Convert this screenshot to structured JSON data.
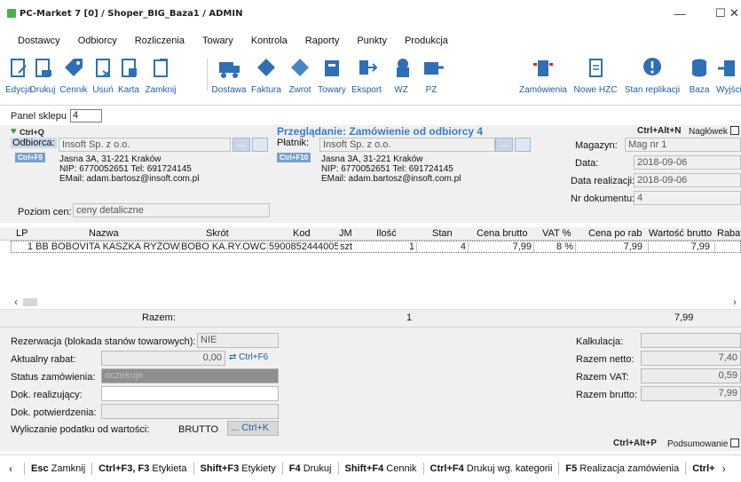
{
  "window": {
    "title": "PC-Market 7 [0] / Shoper_BIG_Baza1 / ADMIN",
    "minimize": "—",
    "maximize": "☐",
    "close": "✕"
  },
  "menu": [
    "Dostawcy",
    "Odbiorcy",
    "Rozliczenia",
    "Towary",
    "Kontrola",
    "Raporty",
    "Punkty",
    "Produkcja"
  ],
  "toolbar": [
    {
      "label": "Edycja",
      "icon": "edit-doc-icon"
    },
    {
      "label": "Drukuj",
      "icon": "print-doc-icon"
    },
    {
      "label": "Cennik",
      "icon": "price-tag-icon"
    },
    {
      "label": "Usuń",
      "icon": "delete-doc-icon"
    },
    {
      "label": "Karta",
      "icon": "card-icon"
    },
    {
      "label": "Zamknij",
      "icon": "close-doc-icon"
    },
    {
      "label": "Dostawa",
      "icon": "delivery-icon"
    },
    {
      "label": "Faktura",
      "icon": "invoice-icon"
    },
    {
      "label": "Zwrot",
      "icon": "return-icon"
    },
    {
      "label": "Towary",
      "icon": "goods-icon"
    },
    {
      "label": "Eksport",
      "icon": "export-icon"
    },
    {
      "label": "WZ",
      "icon": "wz-icon"
    },
    {
      "label": "PZ",
      "icon": "pz-icon"
    },
    {
      "label": "Zamówienia",
      "icon": "orders-icon"
    },
    {
      "label": "Nowe HZC",
      "icon": "new-hzc-icon"
    },
    {
      "label": "Stan replikacji",
      "icon": "replication-icon"
    },
    {
      "label": "Baza",
      "icon": "database-icon"
    },
    {
      "label": "Wyjście",
      "icon": "exit-icon"
    }
  ],
  "panel": {
    "label": "Panel sklepu",
    "value": "4"
  },
  "header": {
    "ctrl_q": "Ctrl+Q",
    "preview_title": "Przeglądanie: Zamówienie od odbiorcy 4",
    "ctrl_alt_n": "Ctrl+Alt+N",
    "naglowek": "Nagłówek",
    "odbiorca_label": "Odbiorca:",
    "odbiorca_value": "Insoft Sp. z o.o.",
    "ctrl_f9": "Ctrl+F9",
    "odbiorca_addr1": "Jasna 3A, 31-221 Kraków",
    "odbiorca_addr2": "NIP: 6770052651 Tel: 691724145",
    "odbiorca_addr3": "EMail: adam.bartosz@insoft.com.pl",
    "platnik_label": "Płatnik:",
    "platnik_value": "Insoft Sp. z o.o.",
    "ctrl_f10": "Ctrl+F10",
    "platnik_addr1": "Jasna 3A, 31-221 Kraków",
    "platnik_addr2": "NIP: 6770052651 Tel: 691724145",
    "platnik_addr3": "EMail: adam.bartosz@insoft.com.pl",
    "dots": "...",
    "poziom_label": "Poziom cen:",
    "poziom_value": "ceny detaliczne",
    "magazyn_label": "Magazyn:",
    "magazyn_value": "Mag nr 1",
    "data_label": "Data:",
    "data_value": "2018-09-06",
    "data_real_label": "Data realizacji:",
    "data_real_value": "2018-09-06",
    "nr_dok_label": "Nr dokumentu:",
    "nr_dok_value": "4"
  },
  "grid": {
    "columns": [
      "LP",
      "Nazwa",
      "Skrót",
      "Kod",
      "JM",
      "Ilość",
      "Stan",
      "Cena brutto",
      "VAT %",
      "Cena po rab",
      "Wartość brutto",
      "Rabat"
    ],
    "rows": [
      [
        "1",
        "BB BOBOVITA KASZKA RYŻOW",
        "BOBO KA.RY.OWC",
        "5900852444005",
        "szt",
        "1",
        "4",
        "7,99",
        "8 %",
        "7,99",
        "7,99",
        ""
      ]
    ],
    "sum_label": "Razem:",
    "sum_qty": "1",
    "sum_value": "7,99"
  },
  "bottom": {
    "rezerwacja_label": "Rezerwacja (blokada stanów towarowych):",
    "rezerwacja_value": "NIE",
    "rabat_label": "Aktualny rabat:",
    "rabat_value": "0,00",
    "ctrl_f6": "Ctrl+F6",
    "status_label": "Status zamówienia:",
    "status_value": "oczekuje",
    "dok_real_label": "Dok. realizujący:",
    "dok_potw_label": "Dok. potwierdzenia:",
    "podatek_label": "Wyliczanie podatku od wartości:",
    "podatek_value": "BRUTTO",
    "ctrl_k": "... Ctrl+K",
    "kalkulacja_label": "Kalkulacja:",
    "razem_netto_label": "Razem netto:",
    "razem_netto_value": "7,40",
    "razem_vat_label": "Razem VAT:",
    "razem_vat_value": "0,59",
    "razem_brutto_label": "Razem brutto:",
    "razem_brutto_value": "7,99",
    "ctrl_alt_p": "Ctrl+Alt+P",
    "podsumowanie": "Podsumowanie"
  },
  "footer": [
    {
      "key": "Esc",
      "label": "Zamknij"
    },
    {
      "key": "Ctrl+F3, F3",
      "label": "Etykieta"
    },
    {
      "key": "Shift+F3",
      "label": "Etykiety"
    },
    {
      "key": "F4",
      "label": "Drukuj"
    },
    {
      "key": "Shift+F4",
      "label": "Cennik"
    },
    {
      "key": "Ctrl+F4",
      "label": "Drukuj wg. kategorii"
    },
    {
      "key": "F5",
      "label": "Realizacja zamówienia"
    },
    {
      "key": "Ctrl+",
      "label": ""
    }
  ],
  "colors": {
    "accent_blue": "#1d5ea8",
    "title_blue": "#3a7bc8",
    "panel_gray": "#f0f0f0"
  }
}
